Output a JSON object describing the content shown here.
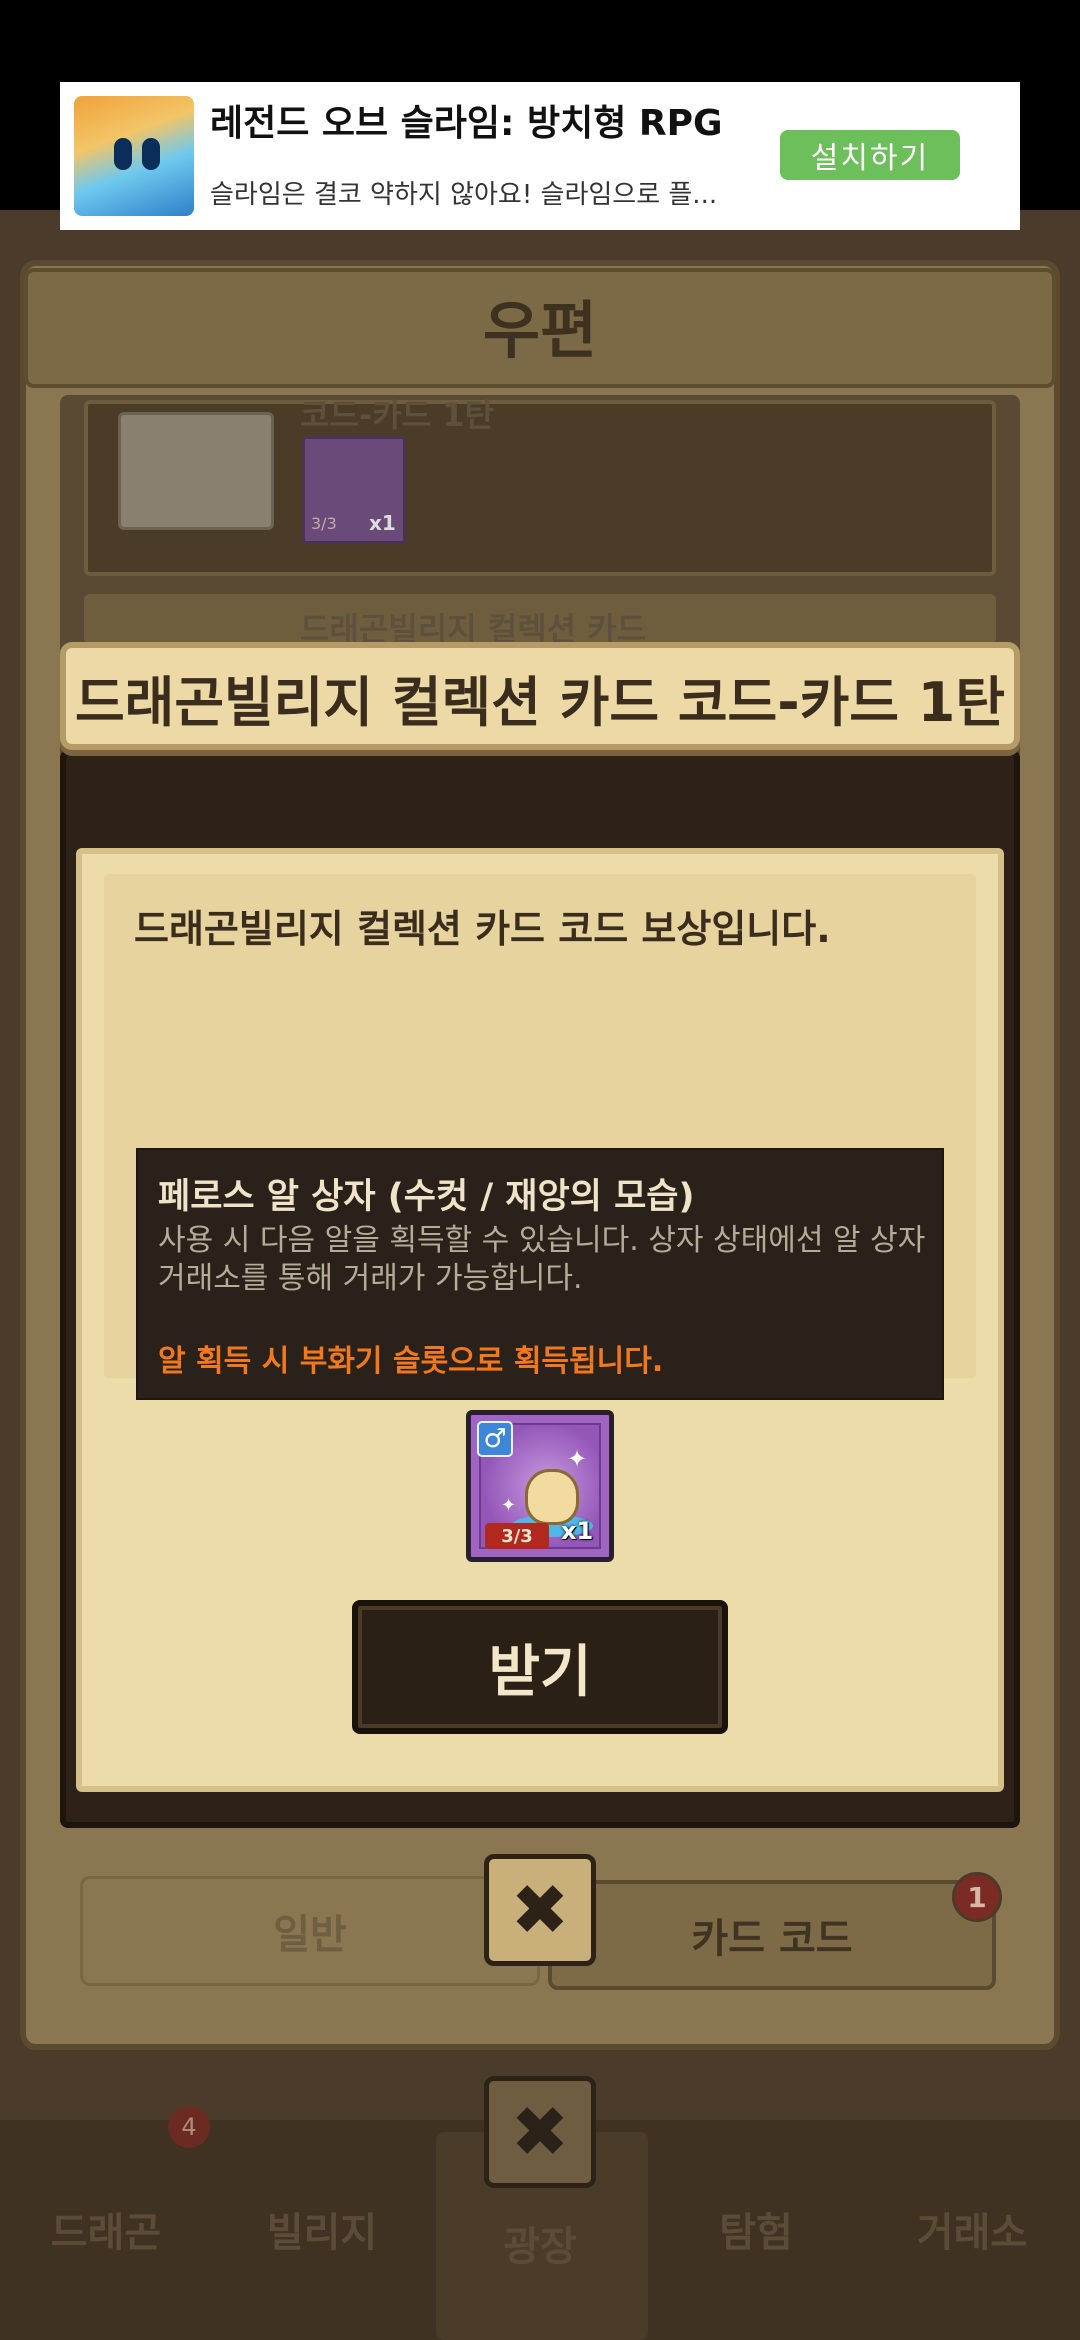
{
  "ad": {
    "title": "레전드 오브 슬라임: 방치형 RPG",
    "description": "슬라임은 결코 약하지 않아요! 슬라임으로 플...",
    "install_label": "설치하기"
  },
  "mailbox": {
    "title": "우편",
    "item1_label": "코드-카드 1탄",
    "item1_card_count": "3/3",
    "item1_card_qty": "x1",
    "item2_label": "드래곤빌리지 컬렉션 카드",
    "tabs": [
      {
        "label": "일반"
      },
      {
        "label": "카드 코드",
        "badge": "1"
      }
    ]
  },
  "bottom_nav": {
    "items": [
      {
        "label": "드래곤",
        "badge": "4"
      },
      {
        "label": "빌리지"
      },
      {
        "label": "광장"
      },
      {
        "label": "탐험"
      },
      {
        "label": "거래소"
      }
    ]
  },
  "dialog": {
    "title": "드래곤빌리지 컬렉션 카드 코드-카드 1탄",
    "message": "드래곤빌리지 컬렉션 카드 코드 보상입니다.",
    "tooltip": {
      "title": "페로스 알 상자 (수컷 / 재앙의 모습)",
      "description": "사용 시 다음 알을 획득할 수 있습니다. 상자 상태에선 알 상자 거래소를 통해 거래가 가능합니다.",
      "warning": "알 획득 시 부화기 슬롯으로 획득됩니다."
    },
    "reward": {
      "gender_symbol": "♂",
      "count": "3/3",
      "quantity": "x1"
    },
    "receive_label": "받기"
  },
  "close_symbol": "✖",
  "colors": {
    "warning": "#f0781e",
    "install_button": "#6cbf5a",
    "card_purple": "#a064c2"
  }
}
